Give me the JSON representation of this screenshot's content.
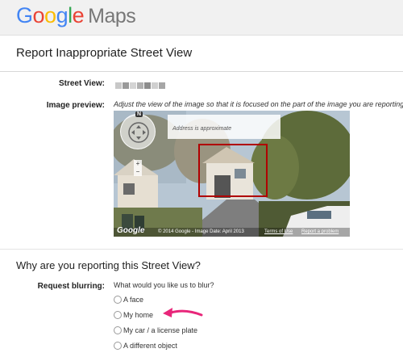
{
  "header": {
    "logo_word": "Google",
    "logo_product": "Maps"
  },
  "page_title": "Report Inappropriate Street View",
  "fields": {
    "street_view_label": "Street View:",
    "image_preview_label": "Image preview:",
    "preview_help": "Adjust the view of the image so that it is focused on the part of the image you are reporting"
  },
  "preview": {
    "address_note": "Address is approximate",
    "watermark": "Google",
    "copyright": "© 2014 Google - Image Date: April 2013",
    "terms_link": "Terms of Use",
    "report_link": "Report a problem",
    "compass_letter": "N",
    "zoom_in": "+",
    "zoom_out": "−"
  },
  "reason": {
    "section_title": "Why are you reporting this Street View?",
    "request_blurring_label": "Request blurring:",
    "question": "What would you like us to blur?",
    "options": [
      {
        "label": "A face",
        "selected": false
      },
      {
        "label": "My home",
        "selected": false
      },
      {
        "label": "My car / a license plate",
        "selected": false
      },
      {
        "label": "A different object",
        "selected": false
      }
    ]
  },
  "colors": {
    "accent_arrow": "#e8267a",
    "selection_box": "#b00000"
  }
}
